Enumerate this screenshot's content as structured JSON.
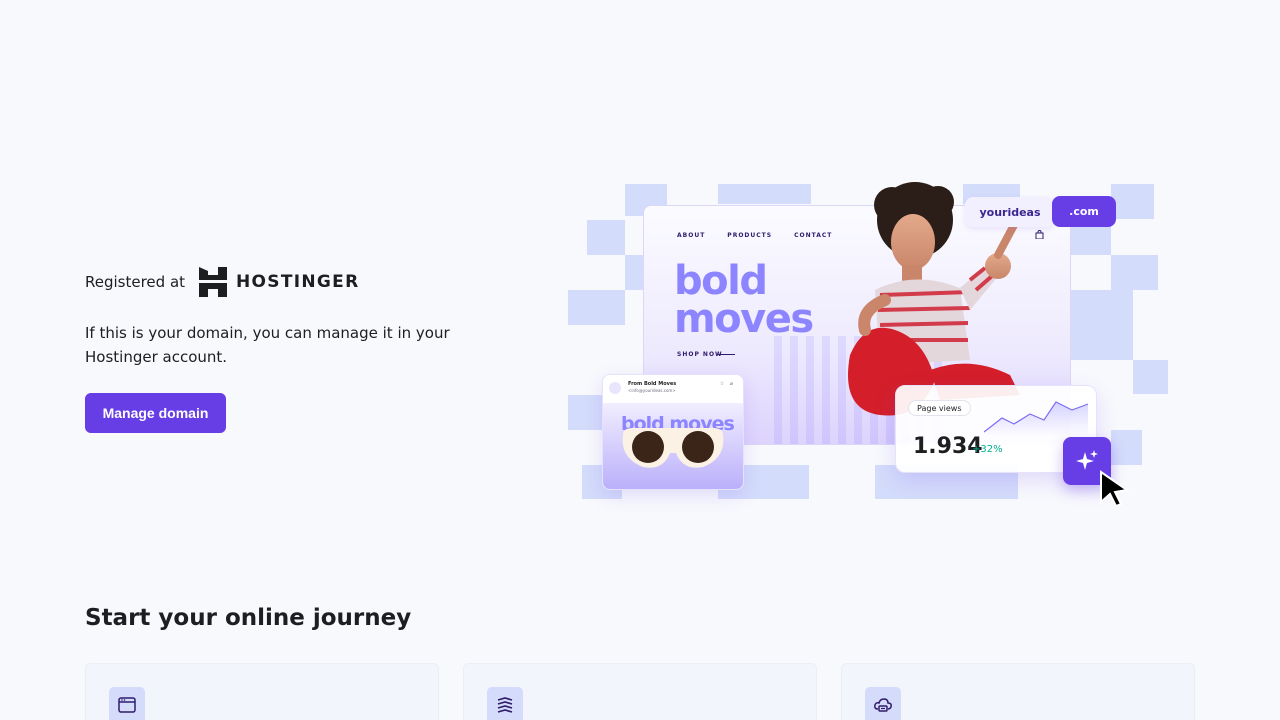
{
  "hero": {
    "registered_label": "Registered at",
    "brand_name": "HOSTINGER",
    "intro_text": "If this is your domain, you can manage it in your Hostinger account.",
    "manage_button": "Manage domain"
  },
  "illustration": {
    "nav": [
      "ABOUT",
      "PRODUCTS",
      "CONTACT"
    ],
    "headline_line1": "bold",
    "headline_line2": "moves",
    "shop_now": "SHOP NOW",
    "domain_name": "yourideas",
    "domain_tld": ".com",
    "email_from": "From Bold Moves",
    "email_address": "<info@yourideas.com>",
    "email_headline": "bold moves",
    "page_views_label": "Page views",
    "page_views_value": "1.934",
    "page_views_growth": "+32%"
  },
  "section": {
    "title": "Start your online journey"
  },
  "cards": [
    {
      "icon": "browser-window-icon"
    },
    {
      "icon": "layers-icon"
    },
    {
      "icon": "cloud-server-icon"
    }
  ],
  "colors": {
    "primary": "#673de6",
    "accent_light": "#8c85ff",
    "tile": "#d4dcfb",
    "background": "#f8f9fd",
    "growth_green": "#00b090"
  }
}
